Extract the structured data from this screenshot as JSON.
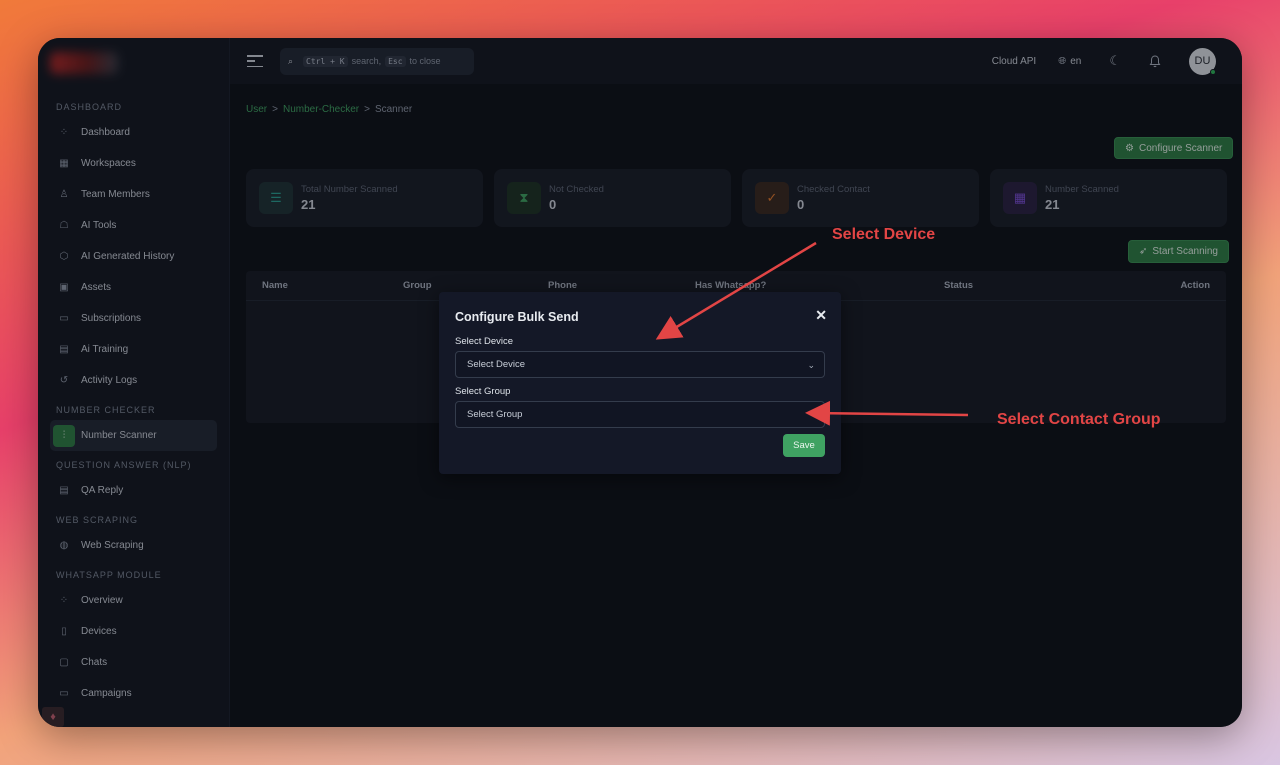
{
  "sidebar": {
    "sections": [
      {
        "title": "DASHBOARD",
        "items": [
          {
            "label": "Dashboard",
            "icon": "grid-circles-icon"
          },
          {
            "label": "Workspaces",
            "icon": "squares-icon"
          },
          {
            "label": "Team Members",
            "icon": "user-icon"
          },
          {
            "label": "AI Tools",
            "icon": "robot-icon"
          },
          {
            "label": "AI Generated History",
            "icon": "cube-icon"
          },
          {
            "label": "Assets",
            "icon": "image-icon"
          },
          {
            "label": "Subscriptions",
            "icon": "card-icon"
          },
          {
            "label": "Ai Training",
            "icon": "book-icon"
          },
          {
            "label": "Activity Logs",
            "icon": "history-icon"
          }
        ]
      },
      {
        "title": "NUMBER CHECKER",
        "items": [
          {
            "label": "Number Scanner",
            "icon": "scanner-icon",
            "active": true
          }
        ]
      },
      {
        "title": "QUESTION ANSWER (NLP)",
        "items": [
          {
            "label": "QA Reply",
            "icon": "message-icon"
          }
        ]
      },
      {
        "title": "WEB SCRAPING",
        "items": [
          {
            "label": "Web Scraping",
            "icon": "globe-icon"
          }
        ]
      },
      {
        "title": "WHATSAPP MODULE",
        "items": [
          {
            "label": "Overview",
            "icon": "grid-circles-icon"
          },
          {
            "label": "Devices",
            "icon": "devices-icon"
          },
          {
            "label": "Chats",
            "icon": "chat-icon"
          },
          {
            "label": "Campaigns",
            "icon": "campaign-icon"
          }
        ]
      }
    ]
  },
  "topbar": {
    "search_kbd1": "Ctrl + K",
    "search_mid": "search,",
    "search_kbd2": "Esc",
    "search_end": "to close",
    "cloud_api": "Cloud API",
    "language": "en",
    "avatar_initials": "DU"
  },
  "breadcrumb": {
    "items": [
      "User",
      "Number-Checker",
      "Scanner"
    ],
    "sep": ">"
  },
  "buttons": {
    "configure_scanner": "Configure Scanner",
    "start_scanning": "Start Scanning"
  },
  "stats": [
    {
      "label": "Total Number Scanned",
      "value": "21",
      "color": "#2a9d8f"
    },
    {
      "label": "Not Checked",
      "value": "0",
      "color": "#3fa262"
    },
    {
      "label": "Checked Contact",
      "value": "0",
      "color": "#e07a2e"
    },
    {
      "label": "Number Scanned",
      "value": "21",
      "color": "#7b4fd6"
    }
  ],
  "table": {
    "columns": [
      "Name",
      "Group",
      "Phone",
      "Has Whatsapp?",
      "Status",
      "Action"
    ]
  },
  "modal": {
    "title": "Configure Bulk Send",
    "device_label": "Select Device",
    "device_placeholder": "Select Device",
    "group_label": "Select Group",
    "group_placeholder": "Select Group",
    "save": "Save"
  },
  "annotations": {
    "device": "Select Device",
    "group": "Select Contact Group"
  }
}
